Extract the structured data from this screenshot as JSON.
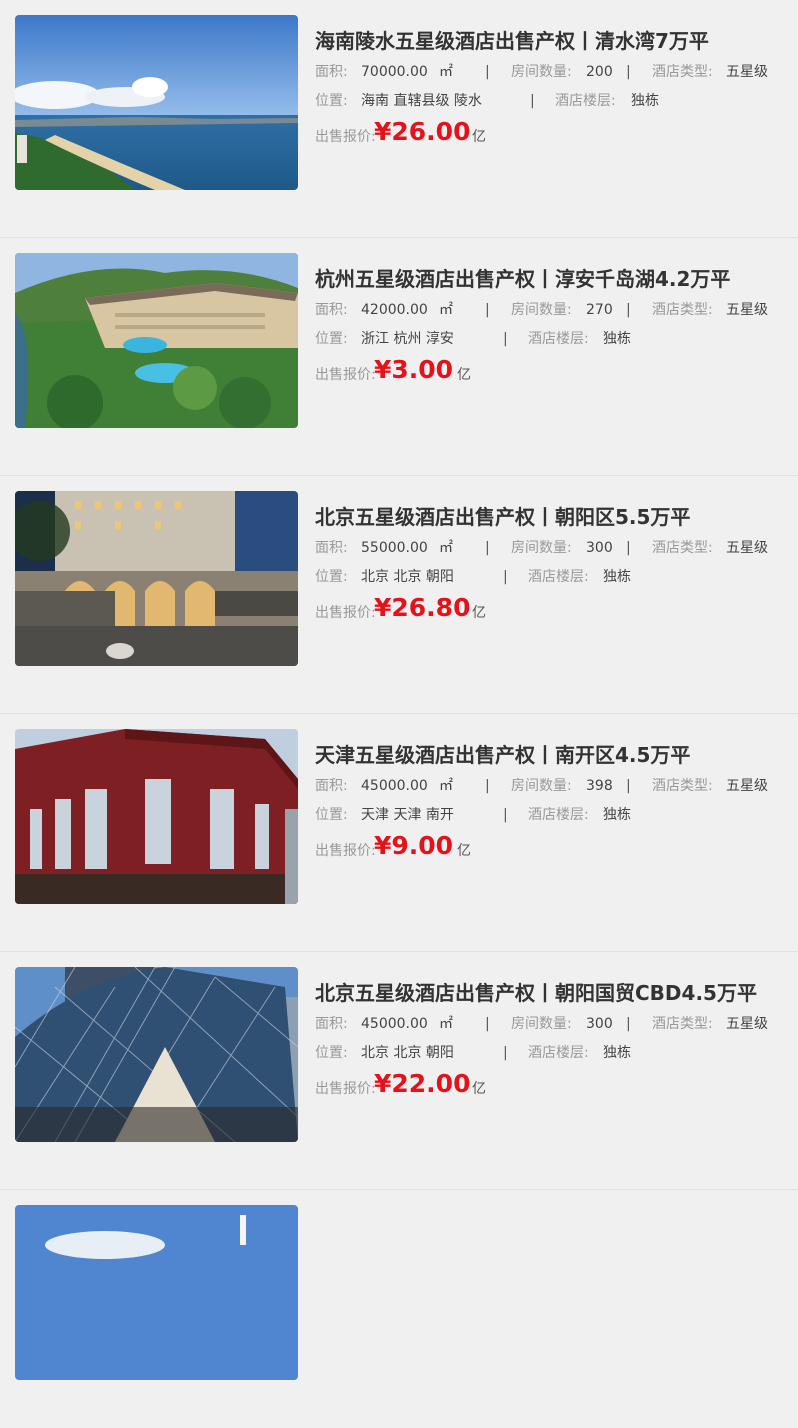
{
  "labels": {
    "area": "面积:",
    "area_unit": "㎡",
    "rooms": "房间数量:",
    "type": "酒店类型:",
    "location": "位置:",
    "floors": "酒店楼层:",
    "price": "出售报价:",
    "price_unit": "亿",
    "separator": "|"
  },
  "listings": [
    {
      "title": "海南陵水五星级酒店出售产权丨清水湾7万平",
      "area": "70000.00",
      "rooms": "200",
      "type": "五星级",
      "location": "海南 直辖县级 陵水",
      "floors": "独栋",
      "price": "¥26.00",
      "image": "beach-resort-photo"
    },
    {
      "title": "杭州五星级酒店出售产权丨淳安千岛湖4.2万平",
      "area": "42000.00",
      "rooms": "270",
      "type": "五星级",
      "location": "浙江 杭州 淳安",
      "floors": "独栋",
      "price": "¥3.00",
      "image": "lakeside-resort-photo"
    },
    {
      "title": "北京五星级酒店出售产权丨朝阳区5.5万平",
      "area": "55000.00",
      "rooms": "300",
      "type": "五星级",
      "location": "北京 北京 朝阳",
      "floors": "独栋",
      "price": "¥26.80",
      "image": "murray-hotel-photo"
    },
    {
      "title": "天津五星级酒店出售产权丨南开区4.5万平",
      "area": "45000.00",
      "rooms": "398",
      "type": "五星级",
      "location": "天津 天津 南开",
      "floors": "独栋",
      "price": "¥9.00",
      "image": "red-brick-hotel-photo"
    },
    {
      "title": "北京五星级酒店出售产权丨朝阳国贸CBD4.5万平",
      "area": "45000.00",
      "rooms": "300",
      "type": "五星级",
      "location": "北京 北京 朝阳",
      "floors": "独栋",
      "price": "¥22.00",
      "image": "glass-tower-hotel-photo"
    },
    {
      "title": "",
      "area": "",
      "rooms": "",
      "type": "",
      "location": "",
      "floors": "",
      "price": "",
      "image": "sky-building-photo"
    }
  ]
}
